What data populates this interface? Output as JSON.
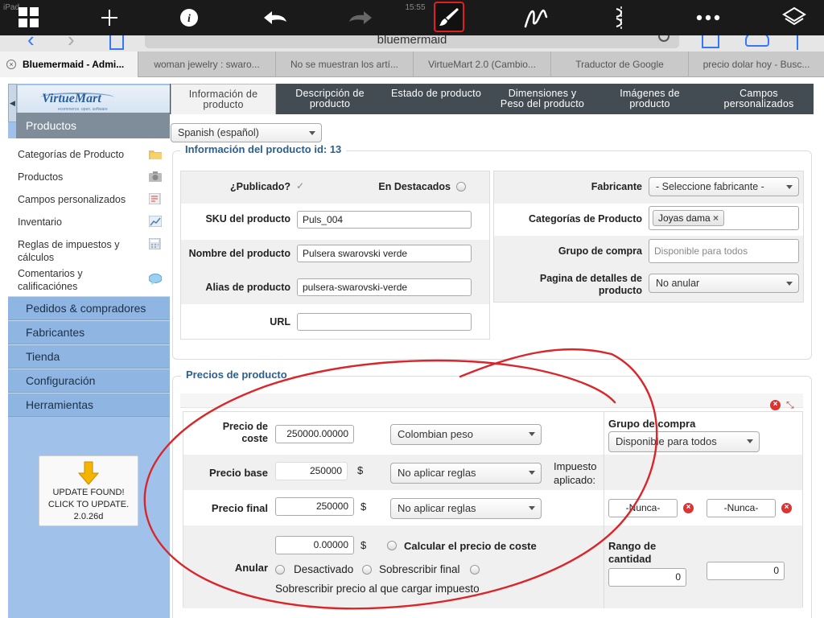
{
  "status_bar": {
    "carrier": "iPad",
    "time": "15:55"
  },
  "ink_toolbar": {
    "tools": [
      "grid-icon",
      "plus-icon",
      "info-icon",
      "undo-icon",
      "redo-icon",
      "brush-icon",
      "pen-icon",
      "scissors-icon",
      "more-icon",
      "layers-icon"
    ],
    "selected": "brush-icon",
    "accent": "#e02020"
  },
  "address_bar": {
    "url": "bluemermaid"
  },
  "browser_tabs": [
    {
      "label": "Bluemermaid - Admi..."
    },
    {
      "label": "woman jewelry : swaro..."
    },
    {
      "label": "No se muestran los artí..."
    },
    {
      "label": "VirtueMart 2.0 (Cambio..."
    },
    {
      "label": "Traductor de Google"
    },
    {
      "label": "precio dolar hoy - Busc..."
    }
  ],
  "sidebar": {
    "logo": "VirtueMart",
    "logo_tagline": "ecommerce. open. software",
    "section": "Productos",
    "items": [
      {
        "label": "Categorías de Producto",
        "icon": "folder-icon"
      },
      {
        "label": "Productos",
        "icon": "camera-icon"
      },
      {
        "label": "Campos personalizados",
        "icon": "fields-icon"
      },
      {
        "label": "Inventario",
        "icon": "chart-icon"
      },
      {
        "label": "Reglas de impuestos y cálculos",
        "icon": "calculator-icon"
      },
      {
        "label": "Comentarios y calificaciónes",
        "icon": "comment-icon"
      }
    ],
    "main_nav": [
      "Pedidos & compradores",
      "Fabricantes",
      "Tienda",
      "Configuración",
      "Herramientas"
    ],
    "update": {
      "line1": "UPDATE FOUND!",
      "line2": "CLICK TO UPDATE.",
      "version": "2.0.26d"
    }
  },
  "product_tabs": [
    {
      "line1": "Información de",
      "line2": "producto"
    },
    {
      "line1": "Descripción de",
      "line2": "producto"
    },
    {
      "line1": "Estado de producto",
      "line2": ""
    },
    {
      "line1": "Dimensiones y",
      "line2": "Peso del producto"
    },
    {
      "line1": "Imágenes de",
      "line2": "producto"
    },
    {
      "line1": "Campos",
      "line2": "personalizados"
    }
  ],
  "language_select": "Spanish (español)",
  "product_info": {
    "legend": "Información del producto id: 13",
    "published_label": "¿Publicado?",
    "featured_label": "En Destacados",
    "sku_label": "SKU del producto",
    "sku": "Puls_004",
    "name_label": "Nombre del producto",
    "name": "Pulsera swarovski verde",
    "alias_label": "Alias de producto",
    "alias": "pulsera-swarovski-verde",
    "url_label": "URL",
    "url": "",
    "manufacturer_label": "Fabricante",
    "manufacturer": "- Seleccione fabricante -",
    "categories_label": "Categorías de Producto",
    "category_tag": "Joyas dama",
    "shopper_group_label": "Grupo de compra",
    "shopper_group_placeholder": "Disponible para todos",
    "detail_page_label_line1": "Pagina de detalles de",
    "detail_page_label_line2": "producto",
    "detail_page": "No anular"
  },
  "prices": {
    "legend": "Precios de producto",
    "cost_label_line1": "Precio de",
    "cost_label_line2": "coste",
    "cost": "250000.00000",
    "currency": "Colombian peso",
    "base_label": "Precio base",
    "base": "250000",
    "currency_symbol": "$",
    "base_rule": "No aplicar reglas",
    "tax_applied_line1": "Impuesto",
    "tax_applied_line2": "aplicado:",
    "final_label": "Precio final",
    "final": "250000",
    "final_rule": "No aplicar reglas",
    "shopper_group_label": "Grupo de compra",
    "shopper_group": "Disponible para todos",
    "date_from": "-Nunca-",
    "date_to": "-Nunca-",
    "override_label": "Anular",
    "override_value": "0.00000",
    "calc_cost_label": "Calcular el precio de coste",
    "disabled_label": "Desactivado",
    "overwrite_final_label": "Sobrescribir final",
    "overwrite_tax_label": "Sobrescribir precio al que cargar impuesto",
    "quantity_range_line1": "Rango de",
    "quantity_range_line2": "cantidad",
    "qty_start": "0",
    "qty_end": "0"
  },
  "annotation_color": "#d8262b"
}
